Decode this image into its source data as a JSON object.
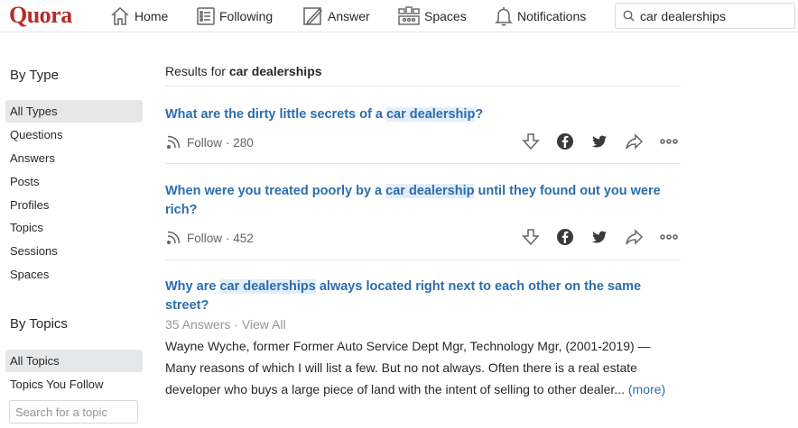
{
  "header": {
    "logo": "Quora",
    "nav": [
      {
        "label": "Home",
        "icon": "home-icon"
      },
      {
        "label": "Following",
        "icon": "following-icon"
      },
      {
        "label": "Answer",
        "icon": "answer-icon"
      },
      {
        "label": "Spaces",
        "icon": "spaces-icon"
      },
      {
        "label": "Notifications",
        "icon": "bell-icon"
      }
    ],
    "search": {
      "value": "car dealerships",
      "icon": "search-icon"
    }
  },
  "sidebar": {
    "by_type_heading": "By Type",
    "types": [
      "All Types",
      "Questions",
      "Answers",
      "Posts",
      "Profiles",
      "Topics",
      "Sessions",
      "Spaces"
    ],
    "by_topics_heading": "By Topics",
    "topics": [
      "All Topics",
      "Topics You Follow"
    ],
    "topic_search_placeholder": "Search for a topic"
  },
  "main": {
    "results_prefix": "Results for",
    "results_query": "car dealerships",
    "results": [
      {
        "title_before": "What are the dirty little secrets of a ",
        "title_highlight": "car dealership",
        "title_after": "?",
        "follow_label": "Follow",
        "follow_count": "· 280"
      },
      {
        "title_before": "When were you treated poorly by a ",
        "title_highlight": "car dealership",
        "title_after": " until they found out you were rich?",
        "follow_label": "Follow",
        "follow_count": "· 452"
      },
      {
        "title_before": "Why are ",
        "title_highlight": "car dealerships",
        "title_after": " always located right next to each other on the same street?",
        "meta": "35 Answers · View All",
        "answer": "Wayne Wyche, former Former Auto Service Dept Mgr, Technology Mgr, (2001-2019) — Many reasons of which I will list a few. But no not always. Often there is a real estate developer who buys a large piece of land with the intent of selling to other dealer...",
        "more": "(more)"
      }
    ],
    "action_icons": [
      "downvote-icon",
      "facebook-icon",
      "twitter-icon",
      "share-icon",
      "more-icon"
    ]
  },
  "colors": {
    "brand": "#b92b27",
    "link": "#2b6dad",
    "highlight": "#e3eefb",
    "muted": "#636466",
    "active_bg": "#e6e7e8"
  }
}
